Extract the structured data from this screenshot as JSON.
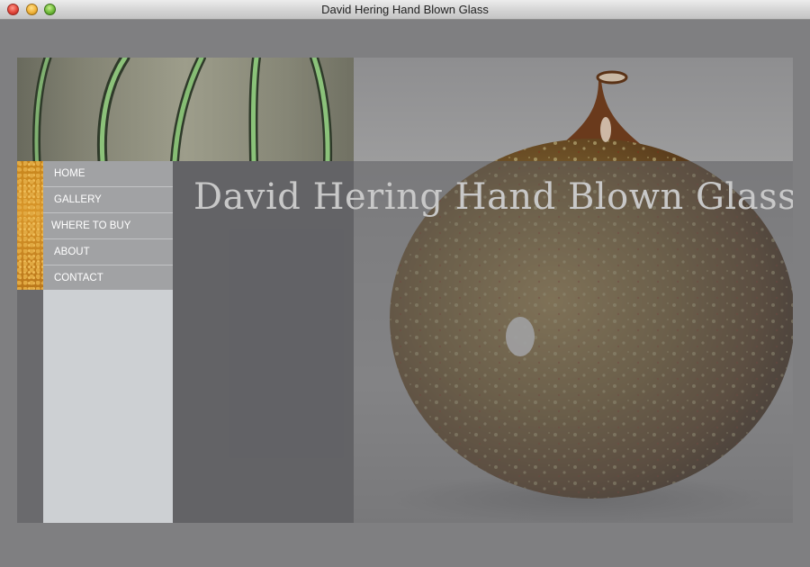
{
  "window": {
    "title": "David Hering Hand Blown Glass"
  },
  "site": {
    "title": "David Hering Hand Blown Glass"
  },
  "nav": [
    {
      "label": "HOME"
    },
    {
      "label": "GALLERY"
    },
    {
      "label": "WHERE TO BUY"
    },
    {
      "label": "ABOUT"
    },
    {
      "label": "CONTACT"
    }
  ],
  "images": {
    "banner": "green-striped-glass-banner",
    "photo": "brown-gold-blown-glass-vase"
  },
  "colors": {
    "background": "#7f7f81",
    "nav_item": "#a1a2a4",
    "nav_fill": "#cdd0d3",
    "accent_gold": "#d8962a",
    "title_text": "#c8c8c8"
  }
}
